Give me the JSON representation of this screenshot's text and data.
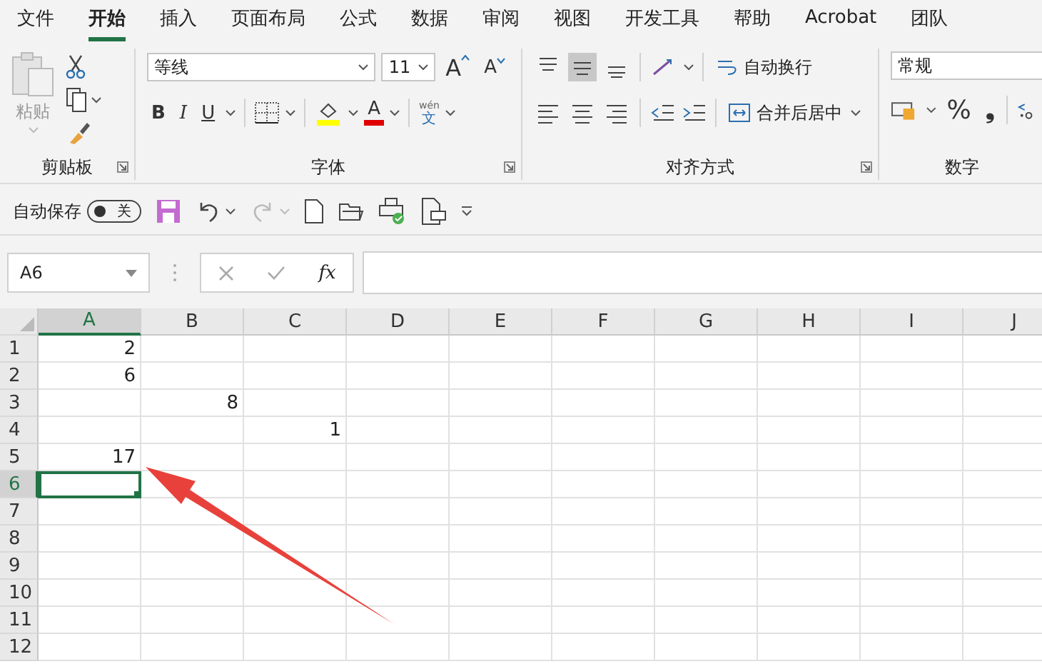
{
  "menu_tabs": [
    {
      "label": "文件",
      "selected": false
    },
    {
      "label": "开始",
      "selected": true
    },
    {
      "label": "插入",
      "selected": false
    },
    {
      "label": "页面布局",
      "selected": false
    },
    {
      "label": "公式",
      "selected": false
    },
    {
      "label": "数据",
      "selected": false
    },
    {
      "label": "审阅",
      "selected": false
    },
    {
      "label": "视图",
      "selected": false
    },
    {
      "label": "开发工具",
      "selected": false
    },
    {
      "label": "帮助",
      "selected": false
    },
    {
      "label": "Acrobat",
      "selected": false
    },
    {
      "label": "团队",
      "selected": false
    }
  ],
  "ribbon": {
    "clipboard": {
      "paste_label": "粘贴",
      "group_label": "剪贴板"
    },
    "font": {
      "font_name": "等线",
      "font_size": "11",
      "grow": "A",
      "shrink": "A",
      "bold": "B",
      "italic": "I",
      "underline": "U",
      "font_color": "A",
      "phonetic_top": "wén",
      "phonetic_bottom": "文",
      "group_label": "字体"
    },
    "alignment": {
      "wrap_text": "自动换行",
      "merge_center": "合并后居中",
      "group_label": "对齐方式"
    },
    "number": {
      "format": "常规",
      "percent": "%",
      "comma": "❟",
      "group_label": "数字"
    }
  },
  "quick_access": {
    "autosave_label": "自动保存",
    "autosave": {
      "on": false,
      "label": "关"
    }
  },
  "formula_bar": {
    "name_box": "A6",
    "function_label": "fx"
  },
  "grid": {
    "columns": [
      {
        "label": "A",
        "selected": true
      },
      {
        "label": "B",
        "selected": false
      },
      {
        "label": "C",
        "selected": false
      },
      {
        "label": "D",
        "selected": false
      },
      {
        "label": "E",
        "selected": false
      },
      {
        "label": "F",
        "selected": false
      },
      {
        "label": "G",
        "selected": false
      },
      {
        "label": "H",
        "selected": false
      },
      {
        "label": "I",
        "selected": false
      },
      {
        "label": "J",
        "selected": false
      }
    ],
    "rows": [
      {
        "header": "1",
        "selected": false,
        "cells": [
          "2"
        ]
      },
      {
        "header": "2",
        "selected": false,
        "cells": [
          "6"
        ]
      },
      {
        "header": "3",
        "selected": false,
        "cells": [
          null,
          "8"
        ]
      },
      {
        "header": "4",
        "selected": false,
        "cells": [
          null,
          null,
          "1"
        ]
      },
      {
        "header": "5",
        "selected": false,
        "cells": [
          "17"
        ]
      },
      {
        "header": "6",
        "selected": true,
        "cells": []
      },
      {
        "header": "7",
        "selected": false,
        "cells": []
      },
      {
        "header": "8",
        "selected": false,
        "cells": []
      },
      {
        "header": "9",
        "selected": false,
        "cells": []
      },
      {
        "header": "10",
        "selected": false,
        "cells": []
      },
      {
        "header": "11",
        "selected": false,
        "cells": []
      },
      {
        "header": "12",
        "selected": false,
        "cells": []
      }
    ]
  }
}
